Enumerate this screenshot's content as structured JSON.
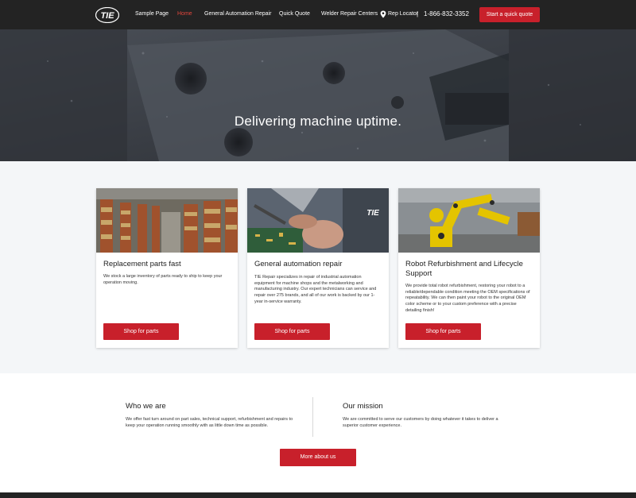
{
  "nav": {
    "logo_text": "TIE",
    "links": [
      "Sample Page",
      "Home",
      "General Automation Repair",
      "Quick Quote",
      "Welder Repair Centers"
    ],
    "rep_locator": "Rep Locator",
    "separator": "|",
    "phone": "1-866-832-3352",
    "cta": "Start a quick quote"
  },
  "hero": {
    "title": "Delivering machine uptime."
  },
  "cards": [
    {
      "title": "Replacement parts fast",
      "text": "We stock a large inventory of parts ready to ship to keep your operation moving.",
      "button": "Shop for parts"
    },
    {
      "title": "General automation repair",
      "text": "TIE Repair specializes in repair of industrial automation equipment for machine shops and the metalworking and manufacturing industry. Our expert technicians can service and repair over 275 brands, and all of our work is backed by our 1-year in-service warranty.",
      "button": "Shop for parts"
    },
    {
      "title": "Robot Refurbishment and Lifecycle Support",
      "text": "We provide total robot refurbishment, restoring your robot to a reliable/dependable condition meeting the OEM specifications of repeatability. We can then paint your robot to the original OEM color scheme or to your custom preference with a precise detailing finish!",
      "button": "Shop for parts"
    }
  ],
  "about": {
    "who_title": "Who we are",
    "who_text": "We offer fast turn around on part sales, technical support, refurbishment and repairs to keep your operation running smoothly with as little down time as possible.",
    "mission_title": "Our mission",
    "mission_text": "We are committed to serve our customers by doing whatever it takes to deliver a superior customer experience.",
    "button": "More about us"
  },
  "colors": {
    "accent": "#c8202b",
    "nav_bg": "#232323",
    "active_link": "#e2463c",
    "section_bg": "#f4f6f8"
  }
}
